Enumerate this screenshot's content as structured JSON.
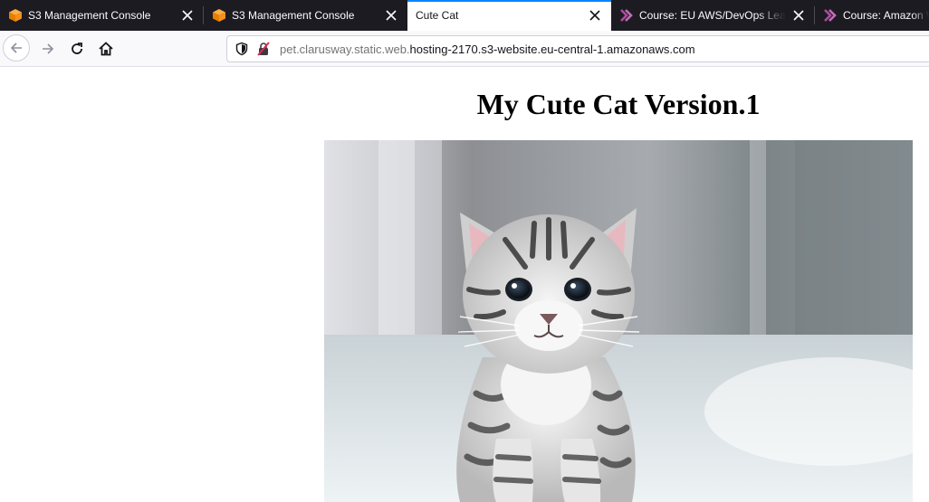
{
  "browser": {
    "tabs": [
      {
        "title": "S3 Management Console",
        "icon": "aws-cube-icon",
        "active": false
      },
      {
        "title": "S3 Management Console",
        "icon": "aws-cube-icon",
        "active": false
      },
      {
        "title": "Cute Cat",
        "icon": "none",
        "active": true
      },
      {
        "title": "Course: EU AWS/DevOps Learn",
        "icon": "course-chevron-icon",
        "active": false
      },
      {
        "title": "Course: Amazon W",
        "icon": "course-chevron-icon",
        "active": false
      }
    ],
    "url": {
      "prefix": "pet.clarusway.static.web.",
      "domain": "hosting-2170.s3-website.eu-central-1.amazonaws.com"
    },
    "colors": {
      "tabbar_bg": "#1c1b22",
      "active_accent": "#0a84ff",
      "aws_orange": "#f7901e",
      "course_purple": "#a94f9b"
    }
  },
  "page": {
    "heading": "My Cute Cat Version.1",
    "image": "tabby-kitten-photo"
  }
}
